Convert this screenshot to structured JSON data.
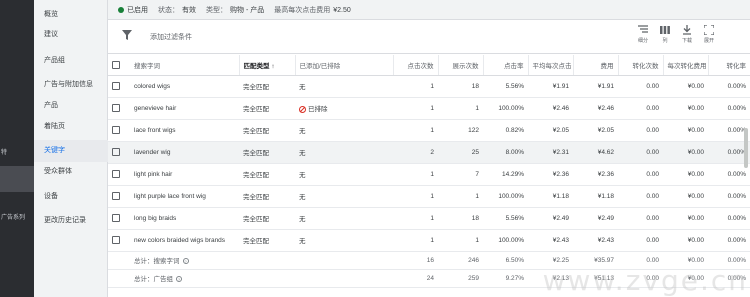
{
  "far_left": {
    "items": [
      {
        "label": "特"
      },
      {
        "label": ""
      },
      {
        "label": "广告系列"
      }
    ]
  },
  "nav": {
    "items": [
      {
        "label": "概览"
      },
      {
        "label": "建议"
      },
      {
        "label": "产品组"
      },
      {
        "label": "广告与附加信息"
      },
      {
        "label": "产品"
      },
      {
        "label": "着陆页"
      },
      {
        "label": "关键字"
      },
      {
        "label": "受众群体"
      },
      {
        "label": "设备"
      },
      {
        "label": "更改历史记录"
      }
    ]
  },
  "status": {
    "enabled": "已启用",
    "state_label": "状态：",
    "state_value": "有效",
    "type_label": "类型：",
    "type_value": "购物 - 产品",
    "maxcpc_label": "最高每次点击费用",
    "maxcpc_value": "¥2.50"
  },
  "toolbar": {
    "filter_placeholder": "添加过滤条件",
    "segment": "细分",
    "columns": "列",
    "download": "下载",
    "expand": "展开"
  },
  "table": {
    "headers": {
      "term": "搜索字词",
      "match": "匹配类型",
      "added": "已添加/已排除",
      "clicks": "点击次数",
      "impr": "展示次数",
      "ctr": "点击率",
      "avg_cpc": "平均每次点击",
      "cost": "费用",
      "conv": "转化次数",
      "cost_conv": "每次转化费用",
      "conv_rate": "转化率"
    },
    "rows": [
      {
        "term": "colored wigs",
        "match": "完全匹配",
        "added": "无",
        "clicks": "1",
        "impr": "18",
        "ctr": "5.56%",
        "avg_cpc": "¥1.91",
        "cost": "¥1.91",
        "conv": "0.00",
        "cost_conv": "¥0.00",
        "conv_rate": "0.00%"
      },
      {
        "term": "genevieve hair",
        "match": "完全匹配",
        "added": "已排除",
        "clicks": "1",
        "impr": "1",
        "ctr": "100.00%",
        "avg_cpc": "¥2.46",
        "cost": "¥2.46",
        "conv": "0.00",
        "cost_conv": "¥0.00",
        "conv_rate": "0.00%"
      },
      {
        "term": "lace front wigs",
        "match": "完全匹配",
        "added": "无",
        "clicks": "1",
        "impr": "122",
        "ctr": "0.82%",
        "avg_cpc": "¥2.05",
        "cost": "¥2.05",
        "conv": "0.00",
        "cost_conv": "¥0.00",
        "conv_rate": "0.00%"
      },
      {
        "term": "lavender wig",
        "match": "完全匹配",
        "added": "无",
        "clicks": "2",
        "impr": "25",
        "ctr": "8.00%",
        "avg_cpc": "¥2.31",
        "cost": "¥4.62",
        "conv": "0.00",
        "cost_conv": "¥0.00",
        "conv_rate": "0.00%"
      },
      {
        "term": "light pink hair",
        "match": "完全匹配",
        "added": "无",
        "clicks": "1",
        "impr": "7",
        "ctr": "14.29%",
        "avg_cpc": "¥2.36",
        "cost": "¥2.36",
        "conv": "0.00",
        "cost_conv": "¥0.00",
        "conv_rate": "0.00%"
      },
      {
        "term": "light purple lace front wig",
        "match": "完全匹配",
        "added": "无",
        "clicks": "1",
        "impr": "1",
        "ctr": "100.00%",
        "avg_cpc": "¥1.18",
        "cost": "¥1.18",
        "conv": "0.00",
        "cost_conv": "¥0.00",
        "conv_rate": "0.00%"
      },
      {
        "term": "long big braids",
        "match": "完全匹配",
        "added": "无",
        "clicks": "1",
        "impr": "18",
        "ctr": "5.56%",
        "avg_cpc": "¥2.49",
        "cost": "¥2.49",
        "conv": "0.00",
        "cost_conv": "¥0.00",
        "conv_rate": "0.00%"
      },
      {
        "term": "new colors braided wigs brands",
        "match": "完全匹配",
        "added": "无",
        "clicks": "1",
        "impr": "1",
        "ctr": "100.00%",
        "avg_cpc": "¥2.43",
        "cost": "¥2.43",
        "conv": "0.00",
        "cost_conv": "¥0.00",
        "conv_rate": "0.00%"
      }
    ],
    "totals": [
      {
        "label": "总计：搜索字词",
        "clicks": "16",
        "impr": "246",
        "ctr": "6.50%",
        "avg_cpc": "¥2.25",
        "cost": "¥35.97",
        "conv": "0.00",
        "cost_conv": "¥0.00",
        "conv_rate": "0.00%"
      },
      {
        "label": "总计：广告组",
        "clicks": "24",
        "impr": "259",
        "ctr": "9.27%",
        "avg_cpc": "¥2.13",
        "cost": "¥51.13",
        "conv": "0.00",
        "cost_conv": "¥0.00",
        "conv_rate": "0.00%"
      }
    ]
  },
  "watermark": "www.zvge.cn",
  "colors": {
    "accent": "#1a73e8",
    "enabled_dot": "#188038",
    "excluded": "#d93025"
  }
}
